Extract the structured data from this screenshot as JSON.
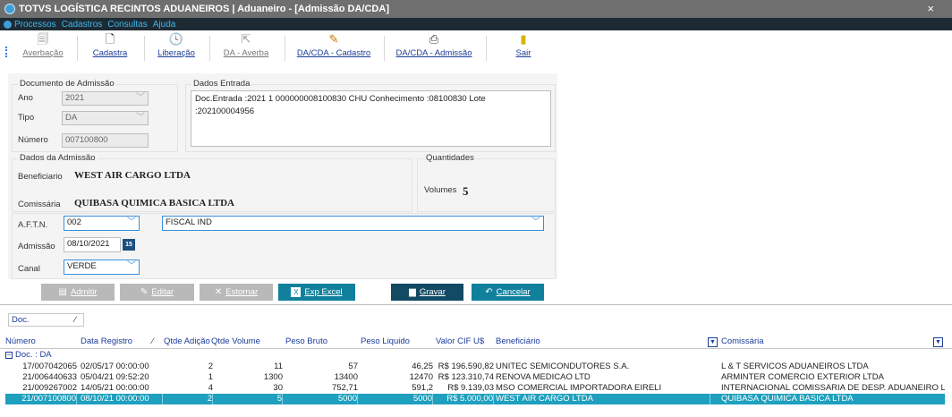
{
  "window": {
    "title": "TOTVS LOGÍSTICA RECINTOS ADUANEIROS | Aduaneiro - [Admissão DA/CDA]",
    "close": "×"
  },
  "menu": [
    "Processos",
    "Cadastros",
    "Consultas",
    "Ajuda"
  ],
  "toolbar": [
    {
      "label": "Averbação",
      "icon": "doc-icon",
      "glyph": "🗐",
      "enabled": false
    },
    {
      "label": "Cadastra",
      "icon": "new-doc-icon",
      "glyph": "🗋",
      "enabled": true
    },
    {
      "label": "Liberação",
      "icon": "clock-icon",
      "glyph": "🕓",
      "enabled": true
    },
    {
      "label": "DA - Averba",
      "icon": "export-icon",
      "glyph": "⇱",
      "enabled": false
    },
    {
      "label": "DA/CDA - Cadastro",
      "icon": "edit-doc-icon",
      "glyph": "✎",
      "enabled": true
    },
    {
      "label": "DA/CDA - Admissão",
      "icon": "stamp-icon",
      "glyph": "⎙",
      "enabled": true
    },
    {
      "label": "Sair",
      "icon": "exit-icon",
      "glyph": "▮",
      "enabled": true
    }
  ],
  "documento": {
    "legend": "Documento de Admissão",
    "ano_label": "Ano",
    "ano": "2021",
    "tipo_label": "Tipo",
    "tipo": "DA",
    "numero_label": "Número",
    "numero": "007100800"
  },
  "dados_entrada": {
    "legend": "Dados Entrada",
    "text": "Doc.Entrada :2021 1 000000008100830 CHU Conhecimento :08100830 Lote :202100004956"
  },
  "admissao": {
    "legend": "Dados da Admissão",
    "beneficiario_label": "Beneficiario",
    "beneficiario": "WEST AIR CARGO LTDA",
    "comissaria_label": "Comissária",
    "comissaria": "QUIBASA QUIMICA BASICA LTDA",
    "aftn_label": "A.F.T.N.",
    "aftn_code": "002",
    "aftn_name": "FISCAL IND",
    "admissao_label": "Admissão",
    "admissao_date": "08/10/2021",
    "calendar_glyph": "15",
    "canal_label": "Canal",
    "canal": "VERDE"
  },
  "quantidades": {
    "legend": "Quantidades",
    "volumes_label": "Volumes",
    "volumes": "5"
  },
  "actions": {
    "admitir": "Admitir",
    "editar": "Editar",
    "estornar": "Estornar",
    "exp_excel": "Exp Excel",
    "gravar": "Gravar",
    "cancelar": "Cancelar"
  },
  "grid": {
    "group_by": "Doc.",
    "columns": [
      "Número",
      "Data Registro",
      "Qtde Adição",
      "Qtde Volume",
      "Peso Bruto",
      "Peso Liquido",
      "Valor CIF U$",
      "Beneficiário",
      "Comissária"
    ],
    "group_label": "Doc. : DA",
    "rows": [
      [
        "17/007042065",
        "02/05/17 00:00:00",
        "2",
        "11",
        "57",
        "46,25",
        "R$ 196.590,82",
        "UNITEC SEMICONDUTORES S.A.",
        "L & T SERVICOS ADUANEIROS LTDA"
      ],
      [
        "21/006440633",
        "05/04/21 09:52:20",
        "1",
        "1300",
        "13400",
        "12470",
        "R$ 123.310,74",
        "RENOVA MEDICAO LTD",
        "ARMINTER COMERCIO EXTERIOR LTDA"
      ],
      [
        "21/009267002",
        "14/05/21 00:00:00",
        "4",
        "30",
        "752,71",
        "591,2",
        "R$ 9.139,03",
        "MSO COMERCIAL IMPORTADORA EIRELI",
        "INTERNACIONAL COMISSARIA DE DESP. ADUANEIRO LTD"
      ],
      [
        "21/007100800",
        "08/10/21 00:00:00",
        "2",
        "5",
        "5000",
        "5000",
        "R$ 5.000,00",
        "WEST AIR CARGO LTDA",
        "QUIBASA QUIMICA BASICA LTDA"
      ]
    ],
    "selected_row": 3
  },
  "colors": {
    "accent": "#11809d",
    "selection": "#1fa0be",
    "menu_text": "#3fb6e8",
    "navy": "#124a63"
  }
}
